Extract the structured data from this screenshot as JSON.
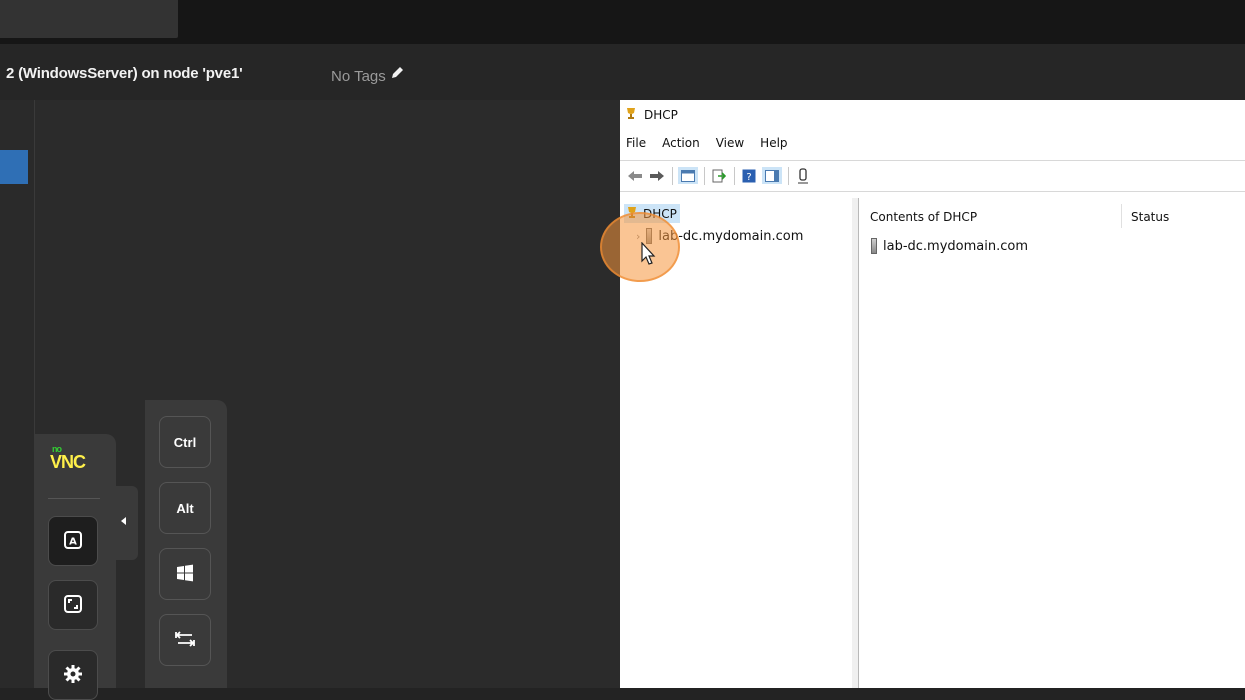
{
  "topbar": {
    "tab_label": ""
  },
  "title": {
    "vm_title": "2 (WindowsServer) on node 'pve1'",
    "tags": "No Tags"
  },
  "novnc": {
    "logo_no": "no",
    "logo_vnc": "VNC",
    "buttons": [
      "keyboard-icon",
      "fullscreen-icon",
      "gear-icon"
    ]
  },
  "extra_keys": {
    "ctrl": "Ctrl",
    "alt": "Alt",
    "windows": "windows-icon",
    "tab": "tab-icon"
  },
  "dhcp_window": {
    "title": "DHCP",
    "menu": [
      "File",
      "Action",
      "View",
      "Help"
    ],
    "tree": {
      "root": "DHCP",
      "server": "lab-dc.mydomain.com"
    },
    "list": {
      "columns": [
        "Contents of DHCP",
        "Status"
      ],
      "rows": [
        {
          "name": "lab-dc.mydomain.com",
          "status": ""
        }
      ]
    }
  },
  "colors": {
    "accent_blue": "#2f6fb5",
    "selection": "#cce4f7",
    "cursor_highlight": "#f59a3c",
    "novnc_yellow": "#fff04a"
  }
}
